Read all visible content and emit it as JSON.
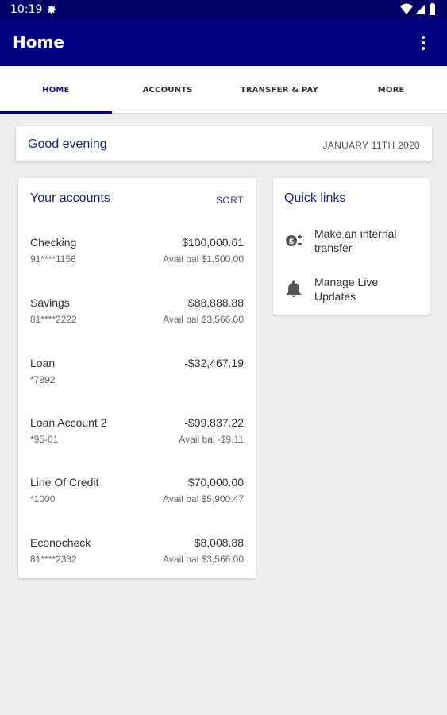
{
  "status_bar": {
    "time": "10:19"
  },
  "app_bar": {
    "title": "Home"
  },
  "tabs": [
    {
      "label": "HOME"
    },
    {
      "label": "ACCOUNTS"
    },
    {
      "label": "TRANSFER & PAY"
    },
    {
      "label": "MORE"
    }
  ],
  "greeting": {
    "text": "Good evening",
    "date": "JANUARY 11TH 2020"
  },
  "accounts": {
    "title": "Your accounts",
    "sort_label": "SORT",
    "items": [
      {
        "name": "Checking",
        "number": "91****1156",
        "balance": "$100,000.61",
        "avail": "Avail bal $1,500.00"
      },
      {
        "name": "Savings",
        "number": "81****2222",
        "balance": "$88,888.88",
        "avail": "Avail bal $3,566.00"
      },
      {
        "name": "Loan",
        "number": "*7892",
        "balance": "-$32,467.19",
        "avail": ""
      },
      {
        "name": "Loan Account 2",
        "number": "*95-01",
        "balance": "-$99,837.22",
        "avail": "Avail bal -$9.11"
      },
      {
        "name": "Line Of Credit",
        "number": "*1000",
        "balance": "$70,000.00",
        "avail": "Avail bal $5,900.47"
      },
      {
        "name": "Econocheck",
        "number": "81****2332",
        "balance": "$8,008.88",
        "avail": "Avail bal $3,566.00"
      }
    ]
  },
  "quick_links": {
    "title": "Quick links",
    "items": [
      {
        "label": "Make an internal transfer",
        "icon": "transfer-money-icon"
      },
      {
        "label": "Manage Live Updates",
        "icon": "bell-icon"
      }
    ]
  },
  "colors": {
    "primary": "#000080",
    "status_bar": "#000066",
    "accent_text": "#1a237e",
    "background": "#eeeeee"
  }
}
